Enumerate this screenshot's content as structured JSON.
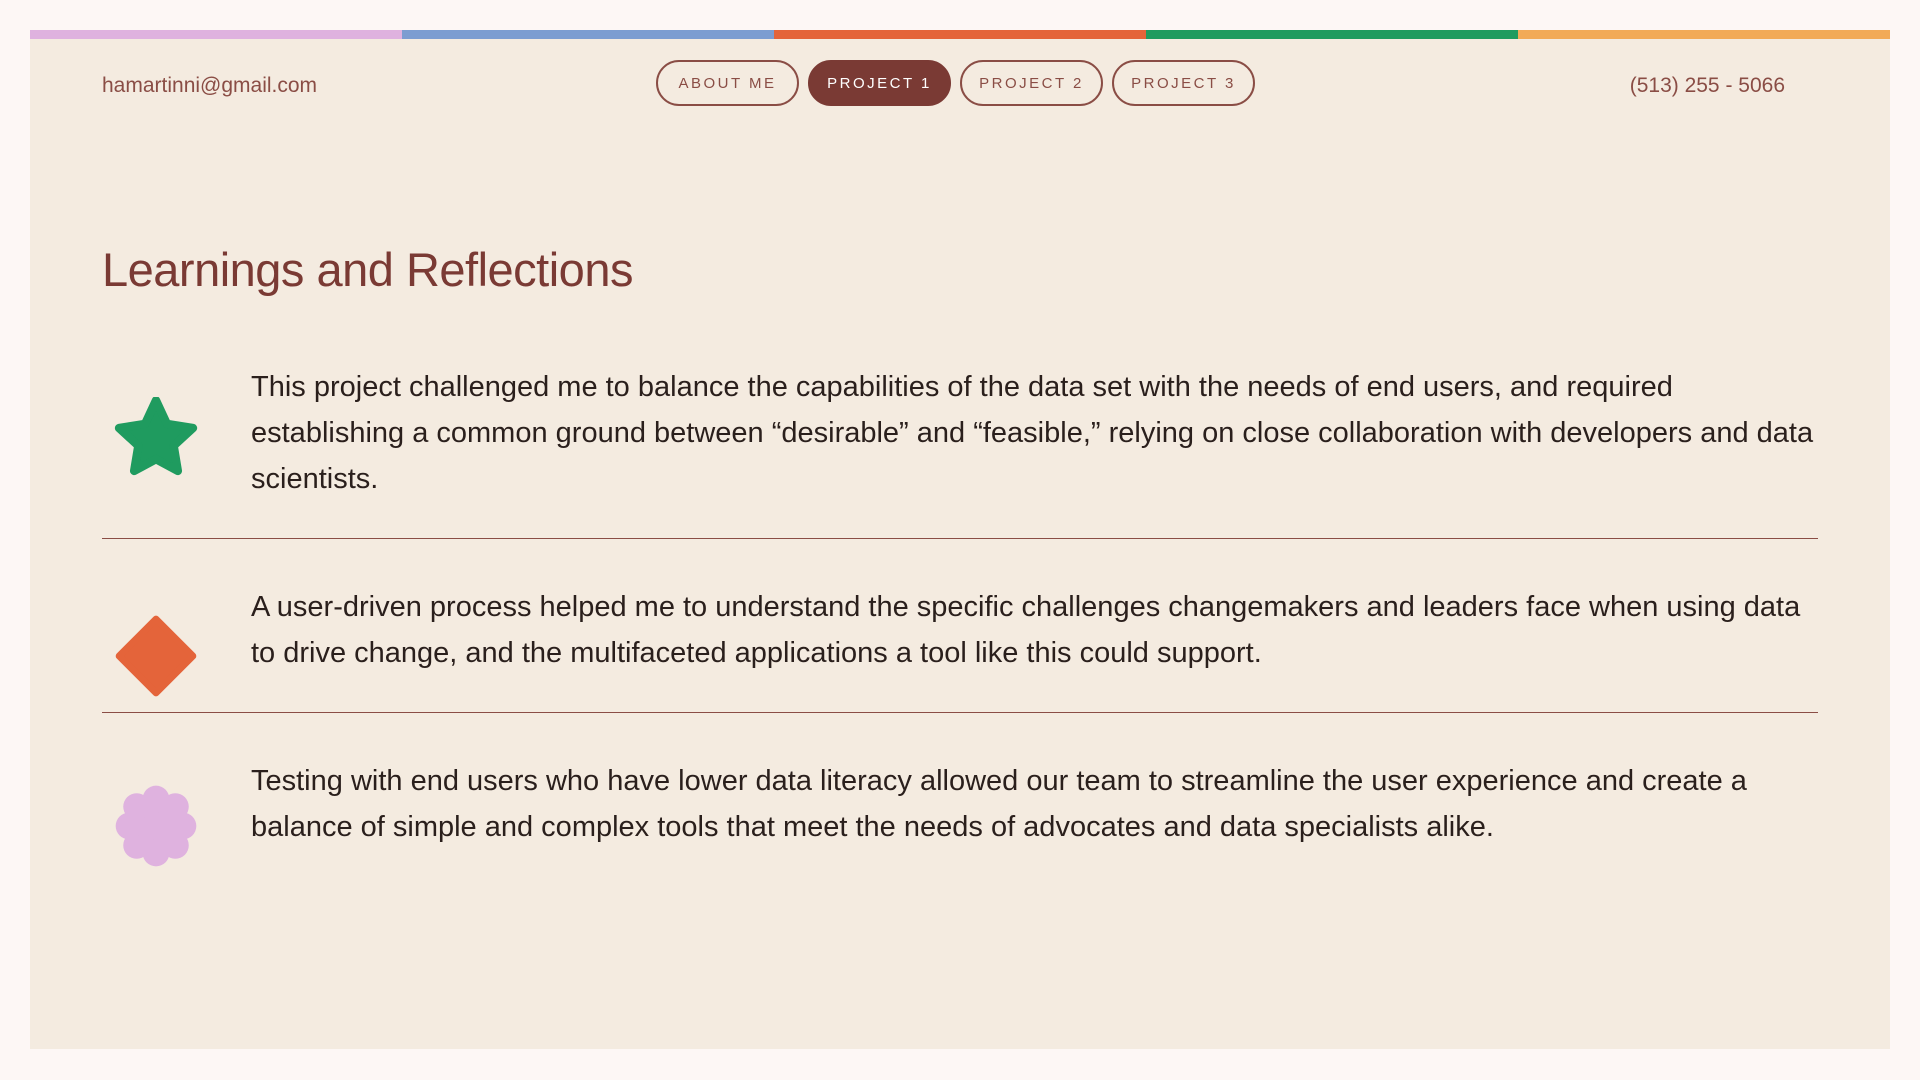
{
  "header": {
    "email": "hamartinni@gmail.com",
    "phone": "(513) 255 - 5066",
    "nav": [
      {
        "label": "ABOUT ME",
        "active": false
      },
      {
        "label": "PROJECT 1",
        "active": true
      },
      {
        "label": "PROJECT 2",
        "active": false
      },
      {
        "label": "PROJECT 3",
        "active": false
      }
    ]
  },
  "color_strip": [
    "#dfb2df",
    "#7c9dd1",
    "#e4643a",
    "#1f9b5f",
    "#f2aa57"
  ],
  "main": {
    "title": "Learnings and Reflections",
    "items": [
      {
        "icon": "star-icon",
        "color": "#1f9b5f",
        "text": "This project challenged me to balance the capabilities of the data set with the needs of end users, and required establishing a common ground between “desirable” and “feasible,” relying on close collaboration with developers and data scientists."
      },
      {
        "icon": "diamond-icon",
        "color": "#e4643a",
        "text": "A user-driven process helped me to understand the specific challenges changemakers and leaders face when using data to drive change, and the multifaceted applications a tool like this could support."
      },
      {
        "icon": "flower-icon",
        "color": "#dfb2df",
        "text": "Testing with end users who have lower data literacy allowed our team to streamline the user experience and create a balance of simple and complex tools that meet the needs of advocates and data specialists alike."
      }
    ]
  }
}
